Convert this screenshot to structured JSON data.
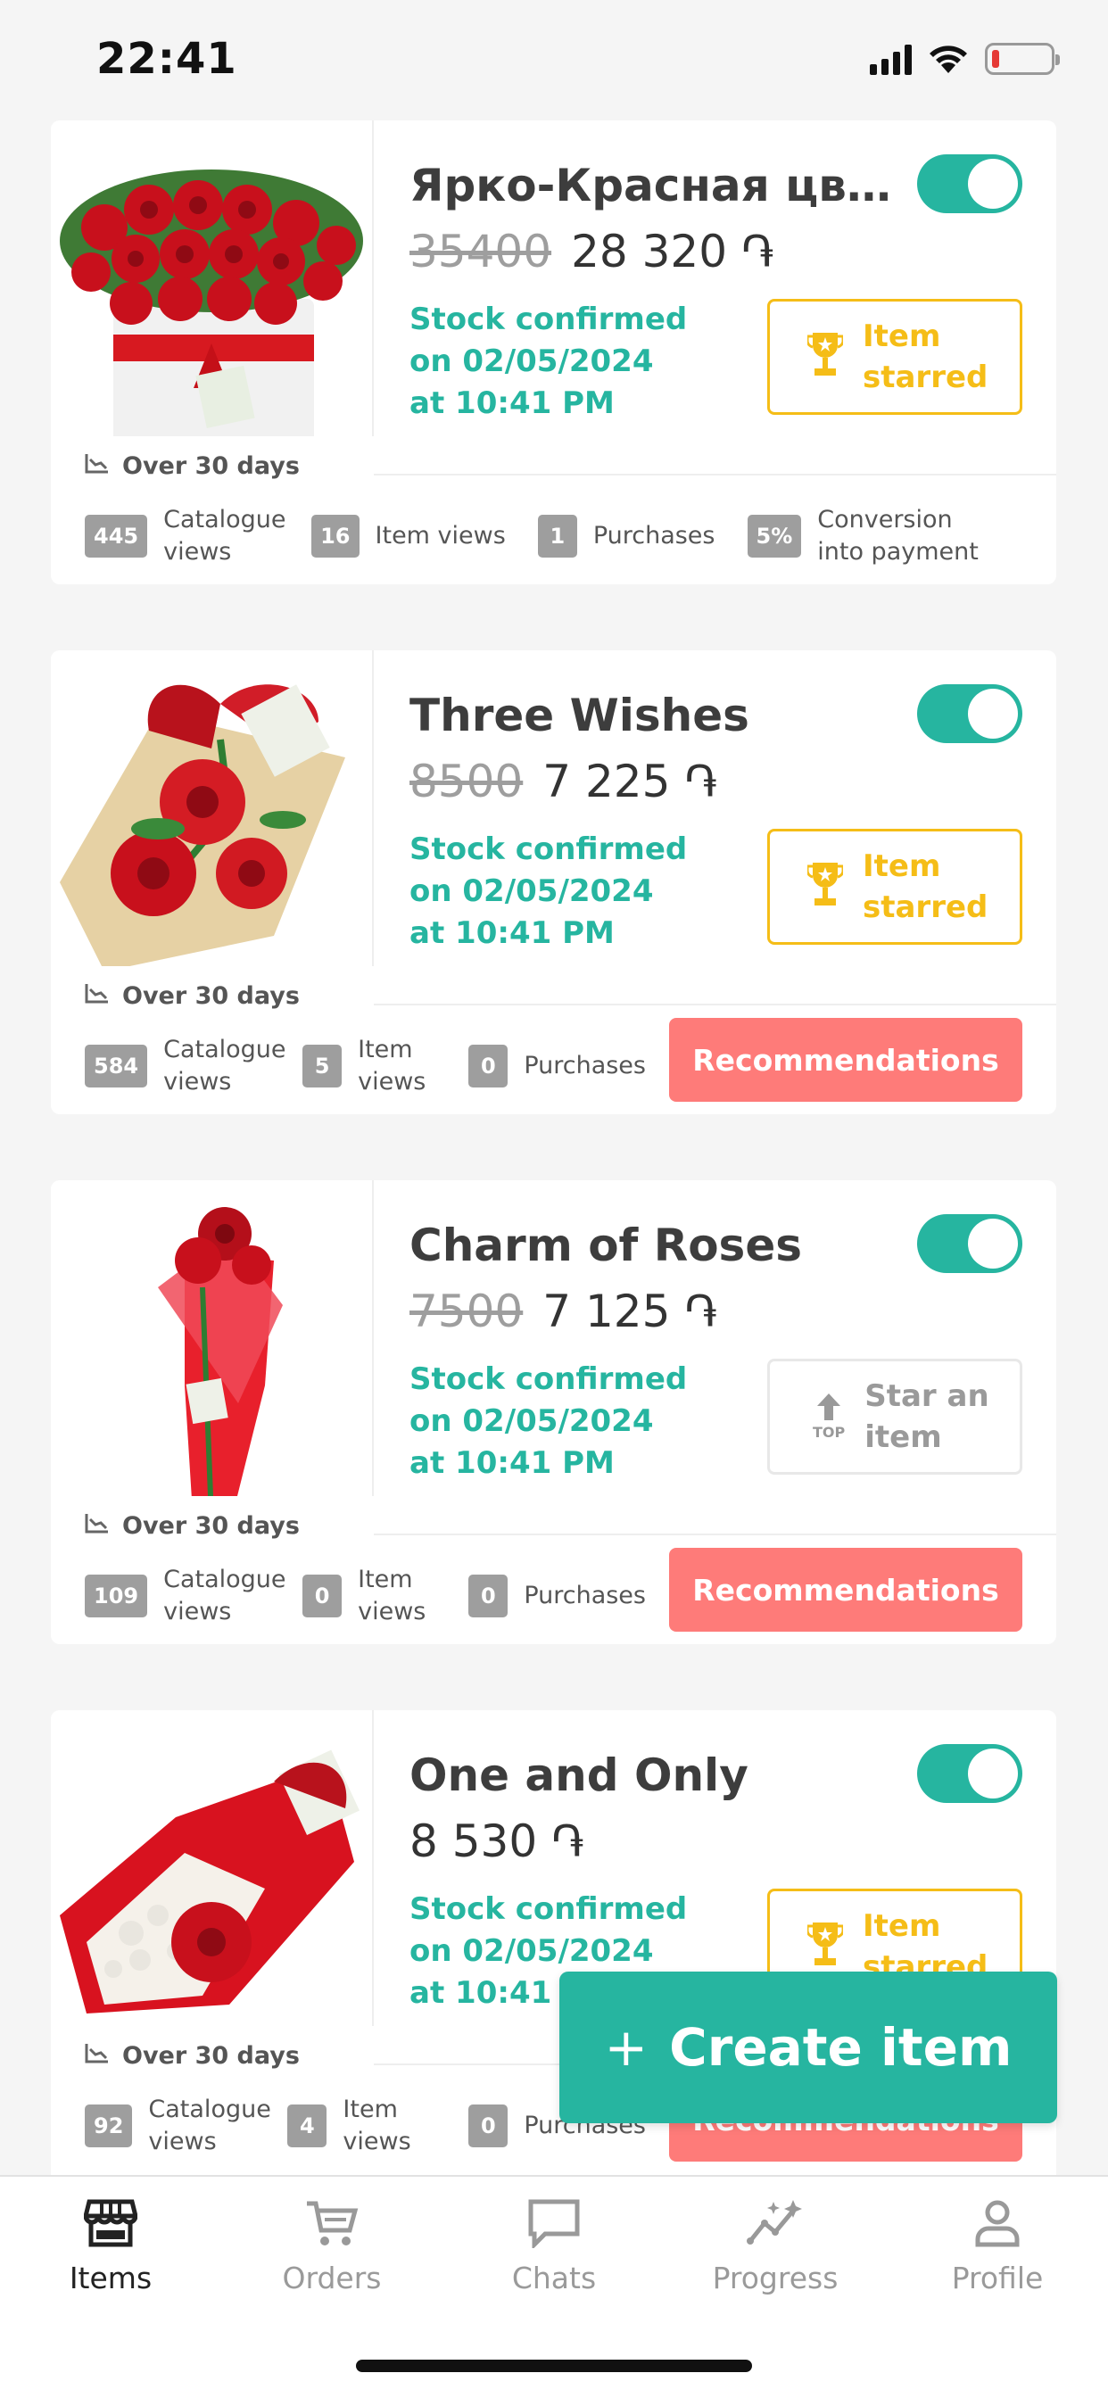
{
  "status_bar": {
    "time": "22:41"
  },
  "colors": {
    "accent": "#26b5a0",
    "star": "#f5bd17",
    "recommend": "#fe7b79",
    "badge": "#9e9e9e"
  },
  "items": [
    {
      "title": "Ярко-Красная цвет...",
      "old_price": "35400",
      "price": "28 320 ֏",
      "stock_text": "Stock confirmed on 02/05/2024 at 10:41 PM",
      "star_label": "Item starred",
      "period": "Over 30 days",
      "stats": [
        {
          "value": "445",
          "label": "Catalogue views"
        },
        {
          "value": "16",
          "label": "Item views"
        },
        {
          "value": "1",
          "label": "Purchases"
        },
        {
          "value": "5%",
          "label": "Conversion into payment"
        }
      ]
    },
    {
      "title": "Three Wishes",
      "old_price": "8500",
      "price": "7 225 ֏",
      "stock_text": "Stock confirmed on 02/05/2024 at 10:41 PM",
      "star_label": "Item starred",
      "period": "Over 30 days",
      "stats": [
        {
          "value": "584",
          "label": "Catalogue views"
        },
        {
          "value": "5",
          "label": "Item views"
        },
        {
          "value": "0",
          "label": "Purchases"
        }
      ],
      "recommendations_label": "Recommendations"
    },
    {
      "title": "Charm of Roses",
      "old_price": "7500",
      "price": "7 125 ֏",
      "stock_text": "Stock confirmed on 02/05/2024 at 10:41 PM",
      "star_label": "Star an item",
      "top_label": "TOP",
      "period": "Over 30 days",
      "stats": [
        {
          "value": "109",
          "label": "Catalogue views"
        },
        {
          "value": "0",
          "label": "Item views"
        },
        {
          "value": "0",
          "label": "Purchases"
        }
      ],
      "recommendations_label": "Recommendations"
    },
    {
      "title": "One and Only",
      "price": "8 530 ֏",
      "stock_text": "Stock confirmed on 02/05/2024 at 10:41 PM",
      "star_label": "Item starred",
      "period": "Over 30 days",
      "stats": [
        {
          "value": "92",
          "label": "Catalogue views"
        },
        {
          "value": "4",
          "label": "Item views"
        },
        {
          "value": "0",
          "label": "Purchases"
        }
      ],
      "recommendations_label": "Recommendations"
    }
  ],
  "create_button": {
    "label": "Create item"
  },
  "tabs": [
    {
      "label": "Items",
      "icon": "store-icon",
      "active": true
    },
    {
      "label": "Orders",
      "icon": "cart-icon",
      "active": false
    },
    {
      "label": "Chats",
      "icon": "chat-icon",
      "active": false
    },
    {
      "label": "Progress",
      "icon": "progress-icon",
      "active": false
    },
    {
      "label": "Profile",
      "icon": "profile-icon",
      "active": false
    }
  ]
}
